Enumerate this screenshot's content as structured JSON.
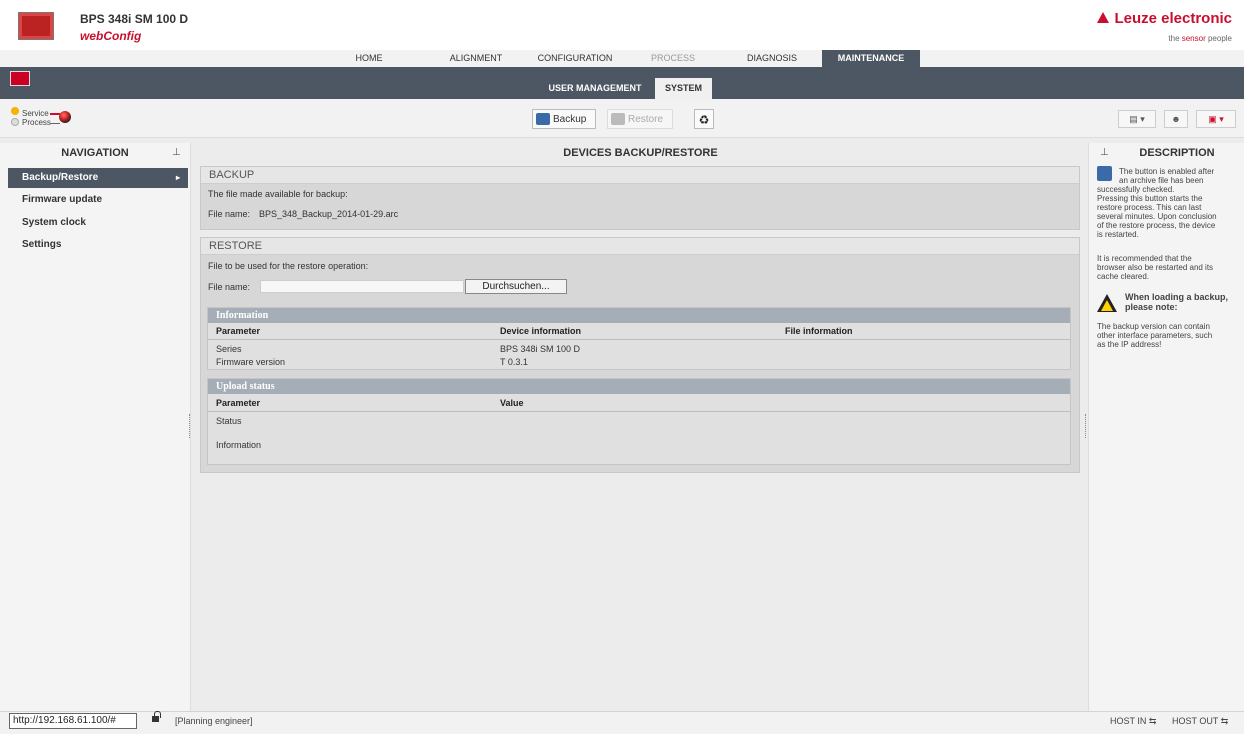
{
  "header": {
    "device_title": "BPS 348i SM 100 D",
    "app_name": "webConfig",
    "brand": "Leuze electronic",
    "tagline_pre": "the ",
    "tagline_em": "sensor",
    "tagline_post": " people"
  },
  "nav_tabs": [
    {
      "label": "HOME"
    },
    {
      "label": "ALIGNMENT"
    },
    {
      "label": "CONFIGURATION"
    },
    {
      "label": "PROCESS"
    },
    {
      "label": "DIAGNOSIS"
    },
    {
      "label": "MAINTENANCE"
    }
  ],
  "sub_tabs": [
    {
      "label": "USER MANAGEMENT"
    },
    {
      "label": "SYSTEM"
    }
  ],
  "toolbar": {
    "service_label": "Service",
    "process_label": "Process",
    "backup_label": "Backup",
    "restore_label": "Restore"
  },
  "navigation": {
    "title": "NAVIGATION",
    "items": [
      {
        "label": "Backup/Restore"
      },
      {
        "label": "Firmware update"
      },
      {
        "label": "System clock"
      },
      {
        "label": "Settings"
      }
    ]
  },
  "main": {
    "title": "DEVICES BACKUP/RESTORE",
    "backup": {
      "title": "BACKUP",
      "text": "The file made available for backup:",
      "file_label": "File name:",
      "file_value": "BPS_348_Backup_2014-01-29.arc"
    },
    "restore": {
      "title": "RESTORE",
      "text": "File to be used for the restore operation:",
      "file_label": "File name:",
      "file_value": "",
      "browse_label": "Durchsuchen..."
    },
    "information": {
      "title": "Information",
      "columns": [
        "Parameter",
        "Device information",
        "File information"
      ],
      "rows": [
        {
          "param": "Series",
          "device": "BPS 348i SM 100 D",
          "file": ""
        },
        {
          "param": "Firmware version",
          "device": "T 0.3.1",
          "file": ""
        }
      ]
    },
    "upload_status": {
      "title": "Upload status",
      "columns": [
        "Parameter",
        "Value"
      ],
      "rows": [
        {
          "param": "Status",
          "value": ""
        },
        {
          "param": "Information",
          "value": ""
        }
      ]
    }
  },
  "description": {
    "title": "DESCRIPTION",
    "lines1": [
      "The button is enabled after",
      "an archive file has been",
      "successfully checked.",
      "Pressing this button starts the",
      "restore process. This can last",
      "several minutes. Upon conclusion",
      "of the restore process, the device",
      "is restarted."
    ],
    "lines2": [
      "It is recommended that the",
      "browser also be restarted and its",
      "cache cleared."
    ],
    "warning_title_1": "When loading a backup,",
    "warning_title_2": "please note:",
    "lines3": [
      "The backup version can contain",
      "other interface parameters, such",
      "as the IP address!"
    ]
  },
  "statusbar": {
    "url": "http://192.168.61.100/#",
    "role": "[Planning engineer]",
    "host_in": "HOST IN",
    "host_out": "HOST OUT"
  },
  "colors": {
    "accent": "#c8102e",
    "nav_dark": "#4d5763"
  }
}
